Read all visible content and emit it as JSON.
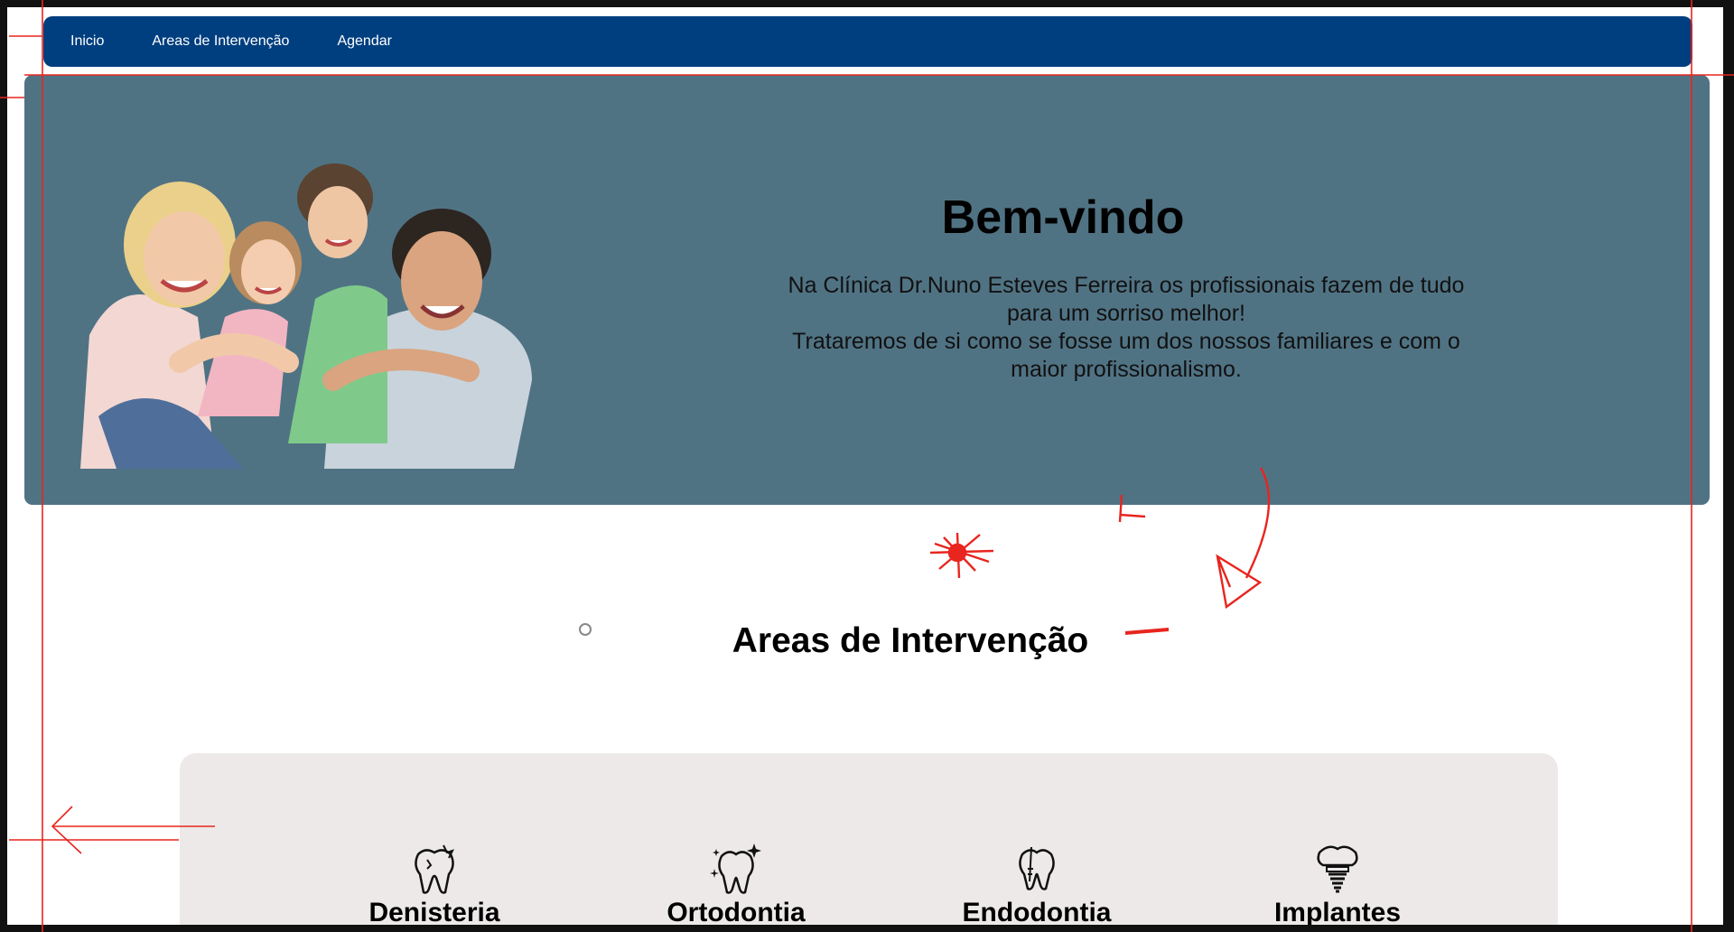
{
  "nav": {
    "items": [
      {
        "label": "Inicio"
      },
      {
        "label": "Areas de Intervenção"
      },
      {
        "label": "Agendar"
      }
    ],
    "color": "#003f7f"
  },
  "hero": {
    "title": "Bem-vindo",
    "lines": [
      "Na Clínica Dr.Nuno Esteves Ferreira os profissionais fazem de tudo",
      "para um sorriso melhor!",
      "Trataremos de si como se fosse um dos nossos familiares e com o",
      "maior profissionalismo."
    ],
    "background": "#507384"
  },
  "areas": {
    "title": "Areas de Intervenção",
    "items": [
      {
        "label": "Denisteria",
        "icon": "broken-tooth-icon"
      },
      {
        "label": "Ortodontia",
        "icon": "sparkling-tooth-icon"
      },
      {
        "label": "Endodontia",
        "icon": "tooth-root-icon"
      },
      {
        "label": "Implantes",
        "icon": "dental-implant-icon"
      }
    ],
    "background": "#ece9e8"
  },
  "annotation_color": "#e8251f"
}
